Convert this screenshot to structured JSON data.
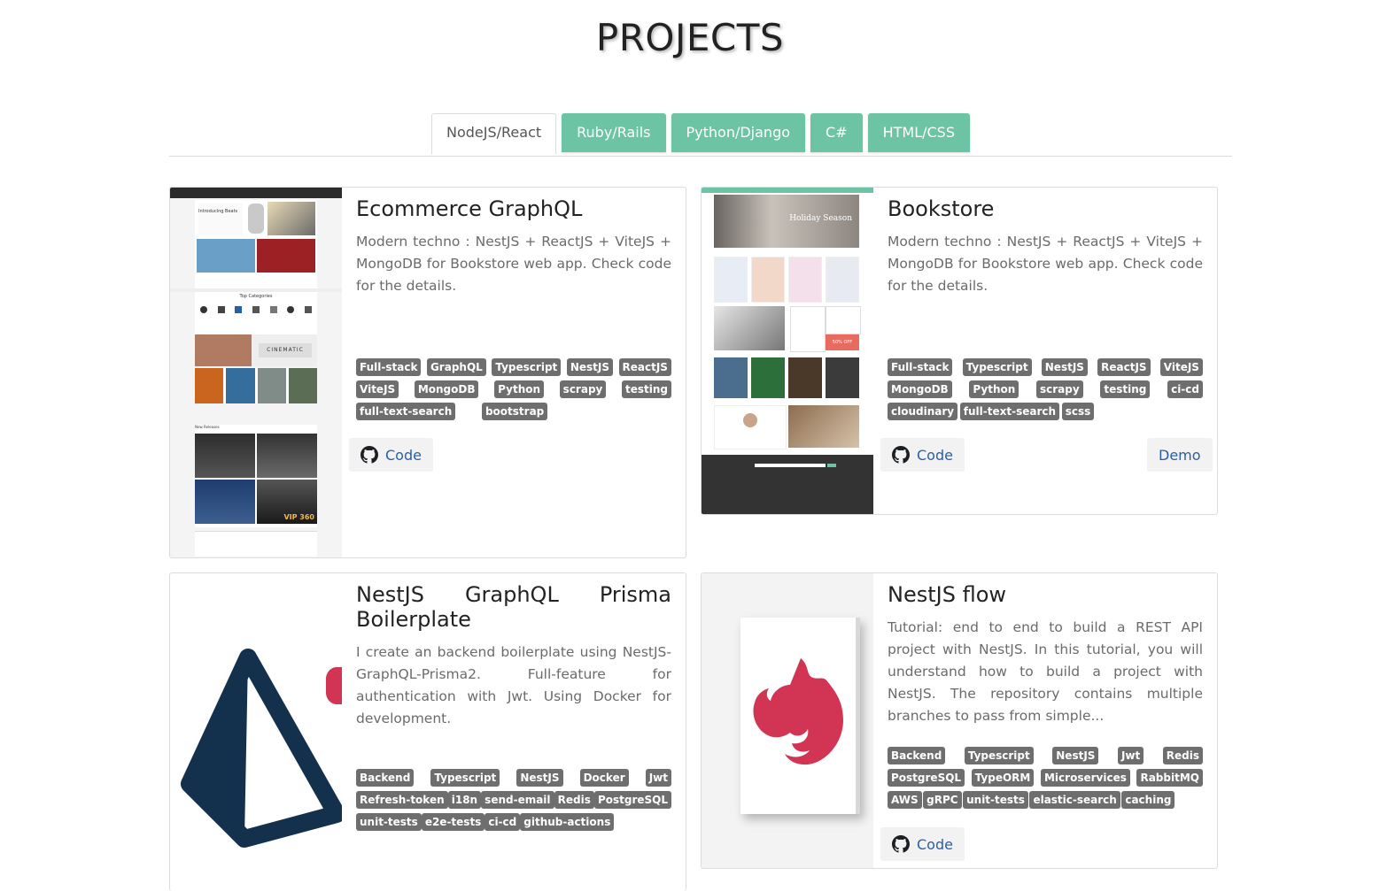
{
  "page": {
    "title": "PROJECTS"
  },
  "tabs": [
    {
      "label": "NodeJS/React",
      "active": true
    },
    {
      "label": "Ruby/Rails",
      "active": false
    },
    {
      "label": "Python/Django",
      "active": false
    },
    {
      "label": "C#",
      "active": false
    },
    {
      "label": "HTML/CSS",
      "active": false
    }
  ],
  "colors": {
    "tab_bg": "#6cc4a4",
    "tag_bg": "#6e6e6e",
    "link": "#2a5fa8",
    "nest_red": "#d23553",
    "prisma_navy": "#13304d"
  },
  "projects": [
    {
      "title": "Ecommerce GraphQL",
      "description": "Modern techno : NestJS + ReactJS + ViteJS + MongoDB for Bookstore web app. Check code for the details.",
      "tags": [
        "Full-stack",
        "GraphQL",
        "Typescript",
        "NestJS",
        "ReactJS",
        "ViteJS",
        "MongoDB",
        "Python",
        "scrapy",
        "testing",
        "full-text-search",
        "bootstrap"
      ],
      "code_label": "Code",
      "thumbnail": {
        "hero_title": "Introducing Beats",
        "categories_heading": "Top Categories",
        "banner": "CINEMATIC",
        "section_new": "New Releases",
        "footer_text": "VIP 360"
      }
    },
    {
      "title": "Bookstore",
      "description": "Modern techno : NestJS + ReactJS + ViteJS + MongoDB for Bookstore web app. Check code for the details.",
      "tags": [
        "Full-stack",
        "Typescript",
        "NestJS",
        "ReactJS",
        "ViteJS",
        "MongoDB",
        "Python",
        "scrapy",
        "testing",
        "ci-cd",
        "cloudinary",
        "full-text-search",
        "scss"
      ],
      "code_label": "Code",
      "demo_label": "Demo",
      "thumbnail": {
        "hero_title": "Holiday Season",
        "sale": "50% OFF"
      }
    },
    {
      "title": "NestJS GraphQL Prisma Boilerplate",
      "description": "I create an backend boilerplate using NestJS-GraphQL-Prisma2. Full-feature for authentication with Jwt. Using Docker for development.",
      "tags": [
        "Backend",
        "Typescript",
        "NestJS",
        "Docker",
        "Jwt",
        "Refresh-token",
        "i18n",
        "send-email",
        "Redis",
        "PostgreSQL",
        "unit-tests",
        "e2e-tests",
        "ci-cd",
        "github-actions"
      ]
    },
    {
      "title": "NestJS flow",
      "description": "Tutorial: end to end to build a REST API project with NestJS. In this tutorial, you will understand how to build a project with NestJS. The repository contains multiple branches to pass from simple...",
      "tags": [
        "Backend",
        "Typescript",
        "NestJS",
        "Jwt",
        "Redis",
        "PostgreSQL",
        "TypeORM",
        "Microservices",
        "RabbitMQ",
        "AWS",
        "gRPC",
        "unit-tests",
        "elastic-search",
        "caching"
      ],
      "code_label": "Code"
    }
  ]
}
